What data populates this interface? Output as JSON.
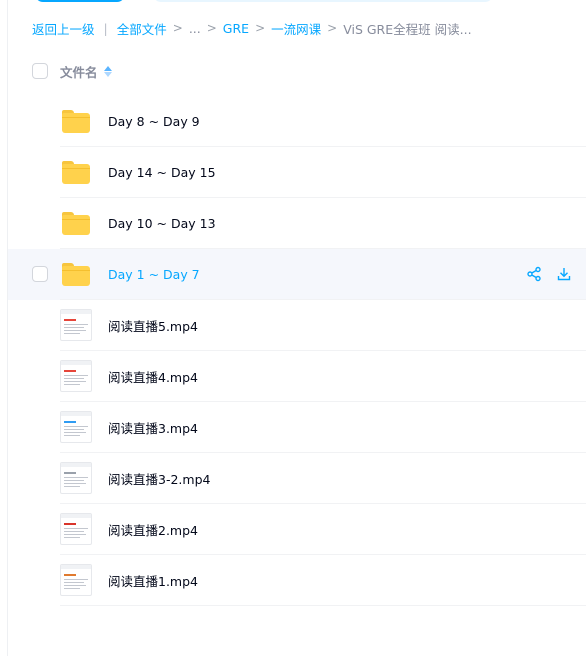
{
  "breadcrumb": {
    "back": "返回上一级",
    "separator": "|",
    "root": "全部文件",
    "ellipsis": "...",
    "arrow": ">",
    "path": [
      "GRE",
      "一流网课"
    ],
    "current": "ViS GRE全程班 阅读..."
  },
  "header": {
    "name_label": "文件名"
  },
  "colors": {
    "accent": "#06a7ff",
    "folder": "#ffd24c",
    "hover_row": "#f5f7fc"
  },
  "files": [
    {
      "name": "Day 8 ~ Day 9",
      "type": "folder-icon"
    },
    {
      "name": "Day 14 ~ Day 15",
      "type": "folder-icon"
    },
    {
      "name": "Day 10 ~ Day 13",
      "type": "folder-icon"
    },
    {
      "name": "Day 1 ~ Day 7",
      "type": "folder-icon",
      "hovered": true
    },
    {
      "name": "阅读直播5.mp4",
      "type": "video-thumbnail"
    },
    {
      "name": "阅读直播4.mp4",
      "type": "video-thumbnail"
    },
    {
      "name": "阅读直播3.mp4",
      "type": "video-thumbnail"
    },
    {
      "name": "阅读直播3-2.mp4",
      "type": "video-thumbnail"
    },
    {
      "name": "阅读直播2.mp4",
      "type": "video-thumbnail"
    },
    {
      "name": "阅读直播1.mp4",
      "type": "video-thumbnail"
    }
  ],
  "row_actions": [
    "share-icon",
    "download-icon"
  ]
}
